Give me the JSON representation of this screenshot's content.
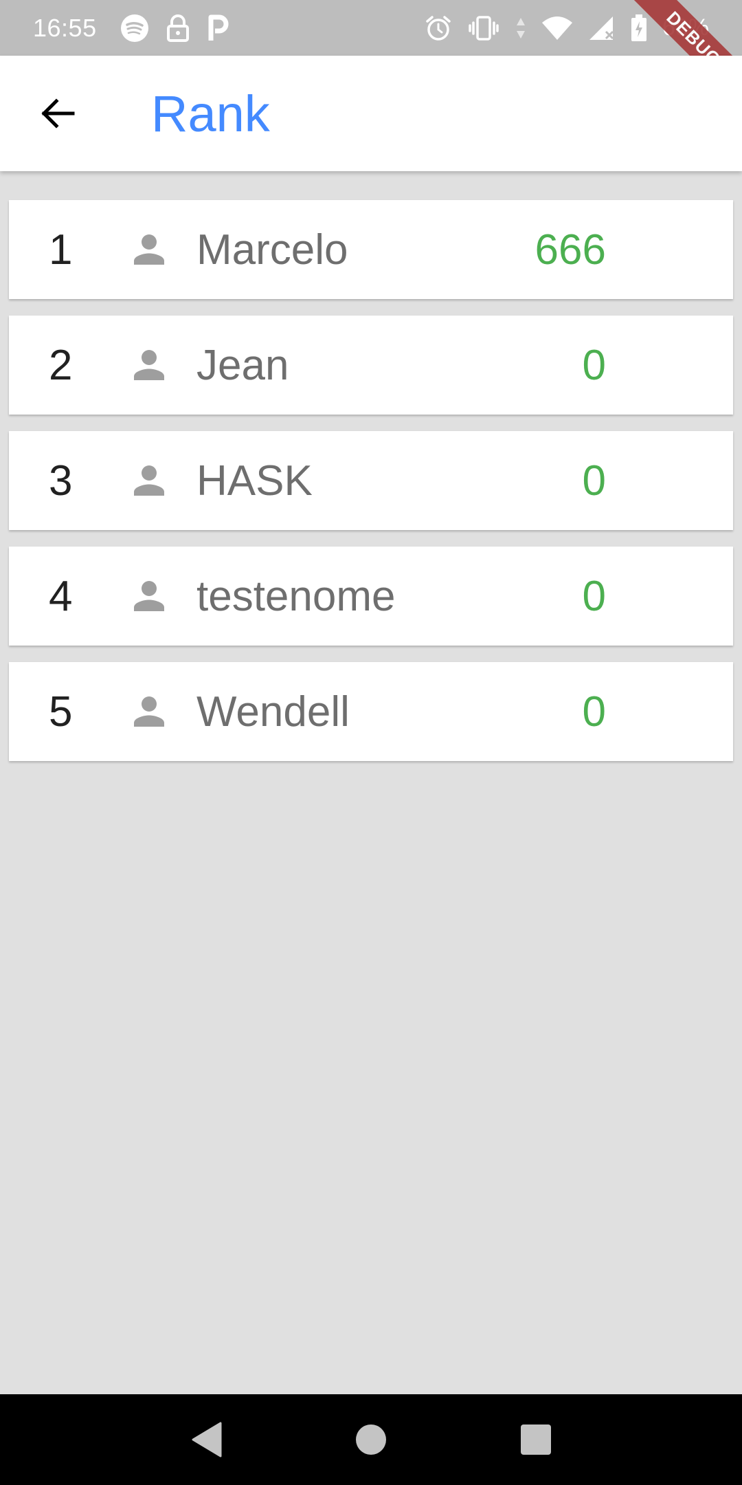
{
  "status_bar": {
    "time": "16:55",
    "battery": "68%",
    "left_icons": [
      "spotify-icon",
      "lock-icon",
      "parking-icon"
    ],
    "right_icons": [
      "alarm-icon",
      "vibrate-icon",
      "data-arrows-icon",
      "wifi-icon",
      "signal-icon",
      "battery-icon"
    ]
  },
  "debug_banner": "DEBUG",
  "app_bar": {
    "title": "Rank",
    "back_icon": "arrow-back-icon"
  },
  "rank": {
    "items": [
      {
        "position": "1",
        "name": "Marcelo",
        "score": "666"
      },
      {
        "position": "2",
        "name": "Jean",
        "score": "0"
      },
      {
        "position": "3",
        "name": "HASK",
        "score": "0"
      },
      {
        "position": "4",
        "name": "testenome",
        "score": "0"
      },
      {
        "position": "5",
        "name": "Wendell",
        "score": "0"
      }
    ]
  },
  "nav_bar": {
    "buttons": [
      "back-triangle-icon",
      "home-circle-icon",
      "recents-square-icon"
    ]
  },
  "colors": {
    "title": "#448aff",
    "score": "#4caf50",
    "status_bar": "#bdbdbd",
    "background": "#e0e0e0",
    "debug": "#a63a3a"
  }
}
